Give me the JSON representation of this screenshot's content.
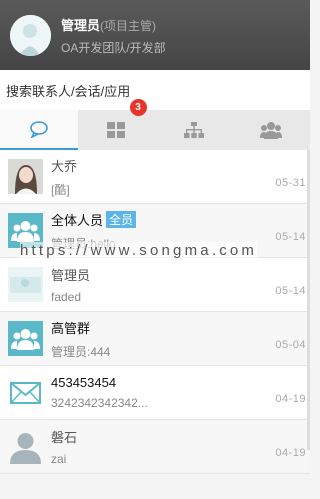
{
  "header": {
    "user_name": "管理员",
    "user_role": "(项目主管)",
    "department": "OA开发团队/开发部"
  },
  "search": {
    "label": "搜索联系人/会话/应用"
  },
  "tabs": [
    {
      "icon": "chat-bubble-icon",
      "active": true
    },
    {
      "icon": "apps-grid-icon",
      "badge": "3"
    },
    {
      "icon": "org-chart-icon"
    },
    {
      "icon": "group-people-icon"
    }
  ],
  "conversations": [
    {
      "title": "大乔",
      "subtitle": "[酷]",
      "time": "05-31",
      "avatar": "person-photo"
    },
    {
      "title": "全体人员",
      "tag": "全员",
      "subtitle": "管理员:hello",
      "time": "05-14",
      "avatar": "group-icon"
    },
    {
      "title": "管理员",
      "subtitle": "faded",
      "time": "05-14",
      "avatar": "person-photo"
    },
    {
      "title": "高管群",
      "subtitle": "管理员:444",
      "time": "05-04",
      "avatar": "group-icon"
    },
    {
      "title": "453453454",
      "subtitle": "3242342342342...",
      "time": "04-19",
      "avatar": "mail-icon"
    },
    {
      "title": "磐石",
      "subtitle": "zai",
      "time": "04-19",
      "avatar": "default-person-icon"
    }
  ],
  "watermark": "https://www.songma.com",
  "colors": {
    "header_bg": "#4a4a4a",
    "accent": "#3a9bd9",
    "badge": "#e8342a",
    "group_avatar": "#5bb8c8"
  }
}
